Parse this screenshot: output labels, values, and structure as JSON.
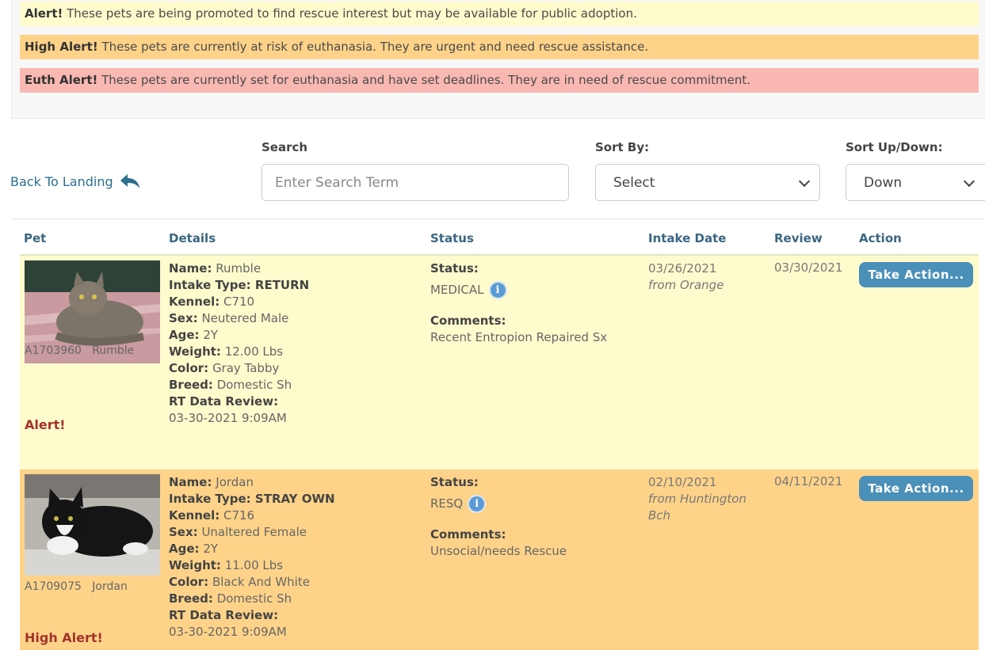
{
  "legend": {
    "alert": {
      "label": "Alert!",
      "text": " These pets are being promoted to find rescue interest but may be available for public adoption.",
      "color": "#fefbcd"
    },
    "high": {
      "label": "High Alert!",
      "text": " These pets are currently at risk of euthanasia. They are urgent and need rescue assistance.",
      "color": "#fed389"
    },
    "euth": {
      "label": "Euth Alert!",
      "text": " These pets are currently set for euthanasia and have set deadlines. They are in need of rescue commitment.",
      "color": "#f9b8b1"
    }
  },
  "controls": {
    "back_link": "Back To Landing",
    "search_label": "Search",
    "search_placeholder": "Enter Search Term",
    "sort_by_label": "Sort By:",
    "sort_by_value": "Select",
    "sort_dir_label": "Sort Up/Down:",
    "sort_dir_value": "Down"
  },
  "table": {
    "headers": {
      "pet": "Pet",
      "details": "Details",
      "status": "Status",
      "intake": "Intake Date",
      "review": "Review",
      "action": "Action"
    },
    "labels": {
      "name": "Name:",
      "intake_type": "Intake Type:",
      "kennel": "Kennel:",
      "sex": "Sex:",
      "age": "Age:",
      "weight": "Weight:",
      "color": "Color:",
      "breed": "Breed:",
      "rt_review": "RT Data Review:",
      "status": "Status:",
      "comments": "Comments:"
    },
    "rows": [
      {
        "id": "A1703960",
        "name": "Rumble",
        "intake_type": "RETURN",
        "kennel": "C710",
        "sex": "Neutered Male",
        "age": "2Y",
        "weight": "12.00 Lbs",
        "color": "Gray Tabby",
        "breed": "Domestic Sh",
        "rt_review": "03-30-2021 9:09AM",
        "status": "MEDICAL",
        "comments": "Recent Entropion Repaired Sx",
        "intake_date": "03/26/2021",
        "intake_from": "from Orange",
        "review": "03/30/2021",
        "alert": "Alert!",
        "action": "Take Action..."
      },
      {
        "id": "A1709075",
        "name": "Jordan",
        "intake_type": "STRAY OWN",
        "kennel": "C716",
        "sex": "Unaltered Female",
        "age": "2Y",
        "weight": "11.00 Lbs",
        "color": "Black And White",
        "breed": "Domestic Sh",
        "rt_review": "03-30-2021 9:09AM",
        "status": "RESQ",
        "comments": "Unsocial/needs Rescue",
        "intake_date": "02/10/2021",
        "intake_from_1": "from Huntington",
        "intake_from_2": "Bch",
        "review": "04/11/2021",
        "alert": "High Alert!",
        "action": "Take Action..."
      }
    ]
  },
  "colors": {
    "link": "#2b6e8e",
    "header": "#3b6680",
    "button": "#4a90b8",
    "alert_text": "#a4342a"
  }
}
